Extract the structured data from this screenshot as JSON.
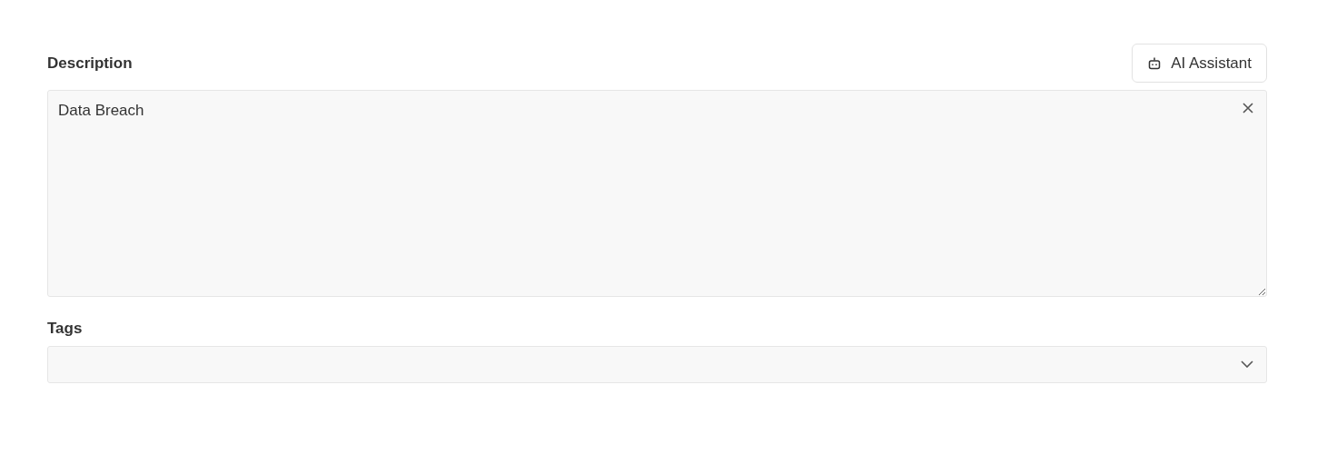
{
  "description": {
    "label": "Description",
    "value": "Data Breach"
  },
  "assistant_button": {
    "label": "AI Assistant"
  },
  "tags": {
    "label": "Tags"
  }
}
